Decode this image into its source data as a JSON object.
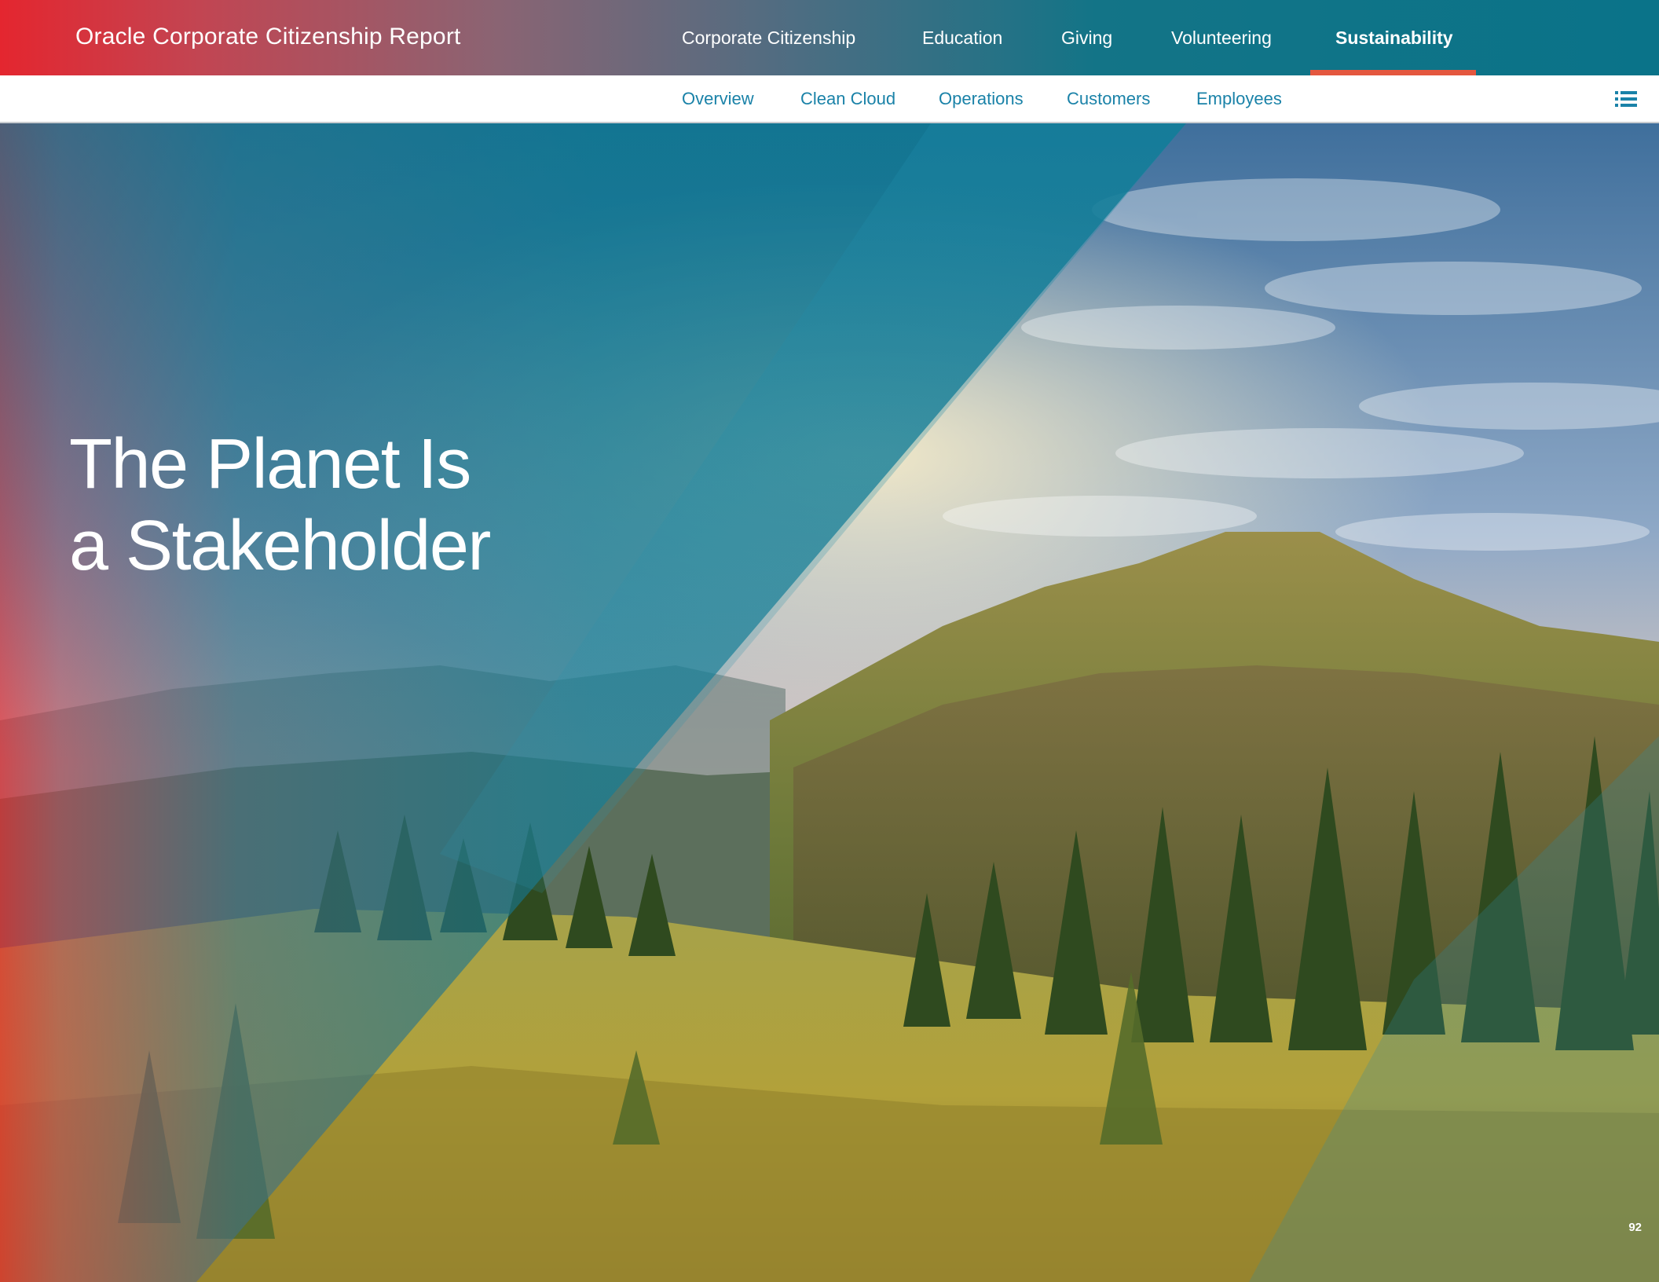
{
  "header": {
    "brand": "Oracle Corporate Citizenship Report",
    "nav": [
      {
        "label": "Corporate Citizenship",
        "active": false
      },
      {
        "label": "Education",
        "active": false
      },
      {
        "label": "Giving",
        "active": false
      },
      {
        "label": "Volunteering",
        "active": false
      },
      {
        "label": "Sustainability",
        "active": true
      }
    ],
    "active_underline_color": "#e4573f"
  },
  "subnav": {
    "items": [
      "Overview",
      "Clean Cloud",
      "Operations",
      "Customers",
      "Employees"
    ],
    "text_color": "#1a82a8",
    "menu_icon": "list-menu-icon"
  },
  "hero": {
    "headline_line1": "The Planet Is",
    "headline_line2": "a Stakeholder",
    "image": "mountain-forest-landscape"
  },
  "footer": {
    "page_number": "92"
  },
  "colors": {
    "brand_red": "#e4262f",
    "brand_teal": "#0a7389",
    "white": "#ffffff"
  }
}
